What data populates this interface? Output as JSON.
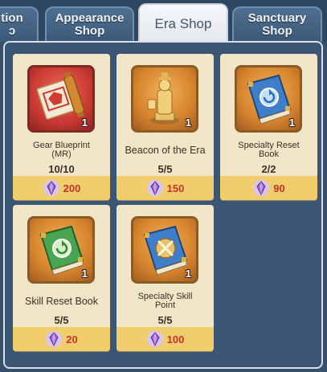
{
  "tabs": [
    {
      "label": "tion\nɔ",
      "active": false
    },
    {
      "label": "Appearance\nShop",
      "active": false
    },
    {
      "label": "Era Shop",
      "active": true
    },
    {
      "label": "Sanctuary\nShop",
      "active": false
    }
  ],
  "items": [
    {
      "name": "Gear Blueprint\n(MR)",
      "quantity": "1",
      "stock": "10/10",
      "price": "200",
      "icon": "gear-blueprint-scroll-icon"
    },
    {
      "name": "Beacon of the Era",
      "quantity": "1",
      "stock": "5/5",
      "price": "150",
      "icon": "golden-statue-icon"
    },
    {
      "name": "Specialty Reset\nBook",
      "quantity": "1",
      "stock": "2/2",
      "price": "90",
      "icon": "blue-reset-book-icon"
    },
    {
      "name": "Skill Reset Book",
      "quantity": "1",
      "stock": "5/5",
      "price": "20",
      "icon": "green-reset-book-icon"
    },
    {
      "name": "Specialty Skill\nPoint",
      "quantity": "1",
      "stock": "5/5",
      "price": "100",
      "icon": "blue-crossed-swords-book-icon"
    }
  ],
  "colors": {
    "price_text": "#c8322a",
    "price_bar": "#f1cd6c",
    "card_bg": "#f2e6c8",
    "panel_bg": "#3a5674"
  },
  "currency_icon": "purple-crystal-icon"
}
